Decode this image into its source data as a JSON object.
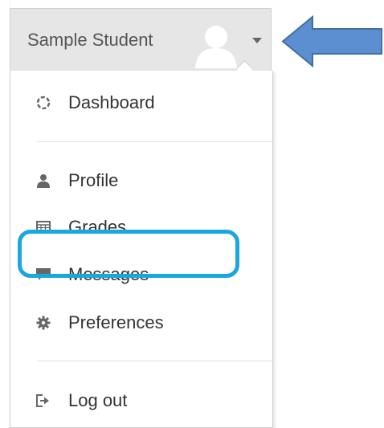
{
  "user_menu": {
    "user_name": "Sample Student",
    "avatar_icon": "user-avatar-icon",
    "caret_icon": "caret-down-icon"
  },
  "annotations": {
    "arrow_color": "#5b8fd1",
    "arrow_border": "#41719c",
    "highlight_color": "#1aa7de"
  },
  "menu": {
    "items": [
      {
        "label": "Dashboard",
        "icon": "dashboard-icon"
      },
      {
        "label": "Profile",
        "icon": "user-icon"
      },
      {
        "label": "Grades",
        "icon": "table-icon"
      },
      {
        "label": "Messages",
        "icon": "comment-icon"
      },
      {
        "label": "Preferences",
        "icon": "gear-icon"
      },
      {
        "label": "Log out",
        "icon": "sign-out-icon"
      }
    ]
  }
}
